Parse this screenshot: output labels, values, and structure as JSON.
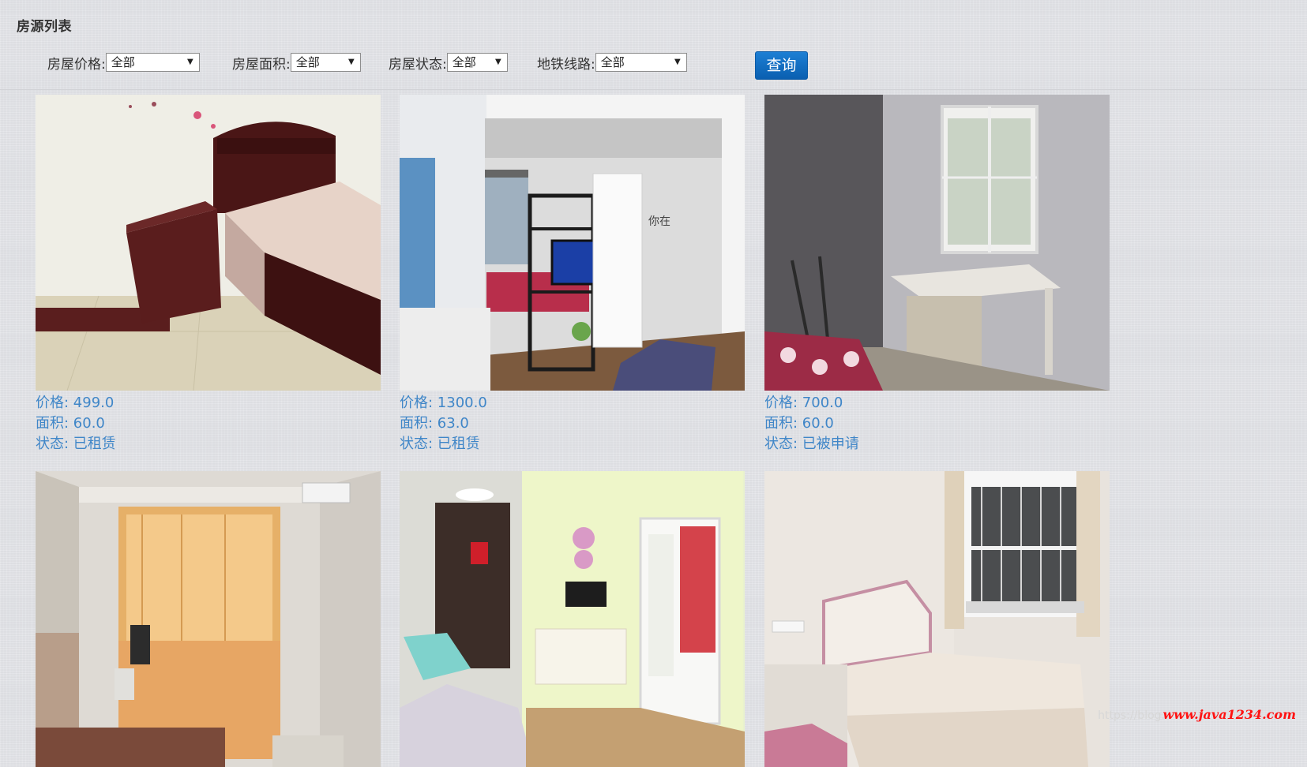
{
  "page": {
    "title": "房源列表"
  },
  "filters": {
    "price": {
      "label": "房屋价格:",
      "value": "全部"
    },
    "area": {
      "label": "房屋面积:",
      "value": "全部"
    },
    "status": {
      "label": "房屋状态:",
      "value": "全部"
    },
    "subway": {
      "label": "地铁线路:",
      "value": "全部"
    },
    "query_label": "查询"
  },
  "listings": [
    {
      "price": "价格: 499.0",
      "area": "面积: 60.0",
      "status": "状态: 已租赁",
      "photo": "bedroom-photo"
    },
    {
      "price": "价格: 1300.0",
      "area": "面积: 63.0",
      "status": "状态: 已租赁",
      "photo": "studio-apartment-photo"
    },
    {
      "price": "价格: 700.0",
      "area": "面积: 60.0",
      "status": "状态: 已被申请",
      "photo": "room-with-window-photo"
    },
    {
      "price": "",
      "area": "",
      "status": "",
      "photo": "room-with-curtains-photo"
    },
    {
      "price": "",
      "area": "",
      "status": "",
      "photo": "living-room-photo"
    },
    {
      "price": "",
      "area": "",
      "status": "",
      "photo": "bedroom-with-window-photo"
    }
  ],
  "watermarks": {
    "site": "www.java1234.com",
    "blog": "https://blog."
  }
}
